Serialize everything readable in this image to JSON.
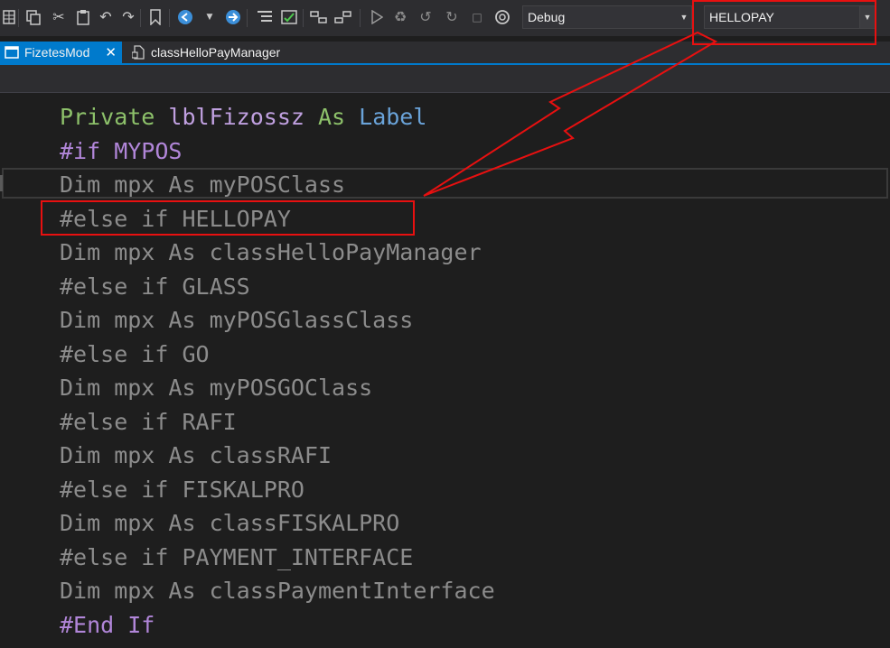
{
  "toolbar": {
    "config_combo": {
      "value": "Debug"
    },
    "symbol_combo": {
      "value": "HELLOPAY"
    },
    "icons": [
      "grid-icon",
      "copy-icon",
      "cut-icon",
      "paste-icon",
      "undo-icon",
      "redo-icon",
      "bookmark-icon",
      "navigate-back-icon",
      "navigate-dropdown-icon",
      "navigate-forward-icon",
      "comment-icon",
      "uncomment-icon",
      "outdent-icon",
      "indent-icon",
      "start-icon",
      "step-over-icon",
      "step-into-icon",
      "step-out-icon",
      "stop-icon",
      "restart-icon"
    ]
  },
  "tabs": [
    {
      "label": "FizetesMod",
      "active": true,
      "close_glyph": "✕"
    },
    {
      "label": "classHelloPayManager",
      "active": false
    }
  ],
  "editor": {
    "lines": [
      [
        {
          "text": "Private",
          "cls": "kw"
        },
        {
          "text": " lblFizossz ",
          "cls": "ident"
        },
        {
          "text": "As",
          "cls": "kw"
        },
        {
          "text": " ",
          "cls": "ident"
        },
        {
          "text": "Label",
          "cls": "type"
        }
      ],
      [
        {
          "text": "#if MYPOS",
          "cls": "directive"
        }
      ],
      [
        {
          "text": "Dim mpx As myPOSClass",
          "cls": "inactive-code"
        }
      ],
      [
        {
          "text": "#else if HELLOPAY",
          "cls": "inactive-code"
        }
      ],
      [
        {
          "text": "Dim mpx As classHelloPayManager",
          "cls": "inactive-code"
        }
      ],
      [
        {
          "text": "#else if GLASS",
          "cls": "inactive-code"
        }
      ],
      [
        {
          "text": "Dim mpx As myPOSGlassClass",
          "cls": "inactive-code"
        }
      ],
      [
        {
          "text": "#else if GO",
          "cls": "inactive-code"
        }
      ],
      [
        {
          "text": "Dim mpx As myPOSGOClass",
          "cls": "inactive-code"
        }
      ],
      [
        {
          "text": "#else if RAFI",
          "cls": "inactive-code"
        }
      ],
      [
        {
          "text": "Dim mpx As classRAFI",
          "cls": "inactive-code"
        }
      ],
      [
        {
          "text": "#else if FISKALPRO",
          "cls": "inactive-code"
        }
      ],
      [
        {
          "text": "Dim mpx As classFISKALPRO",
          "cls": "inactive-code"
        }
      ],
      [
        {
          "text": "#else if PAYMENT_INTERFACE",
          "cls": "inactive-code"
        }
      ],
      [
        {
          "text": "Dim mpx As classPaymentInterface",
          "cls": "inactive-code"
        }
      ],
      [
        {
          "text": "#End If",
          "cls": "directive"
        }
      ]
    ]
  },
  "colors": {
    "annotation_red": "#e81010",
    "accent_blue": "#007acc",
    "keyword_green": "#8dc16a",
    "directive_purple": "#b186d9",
    "inactive_gray": "#8c8c8c"
  }
}
